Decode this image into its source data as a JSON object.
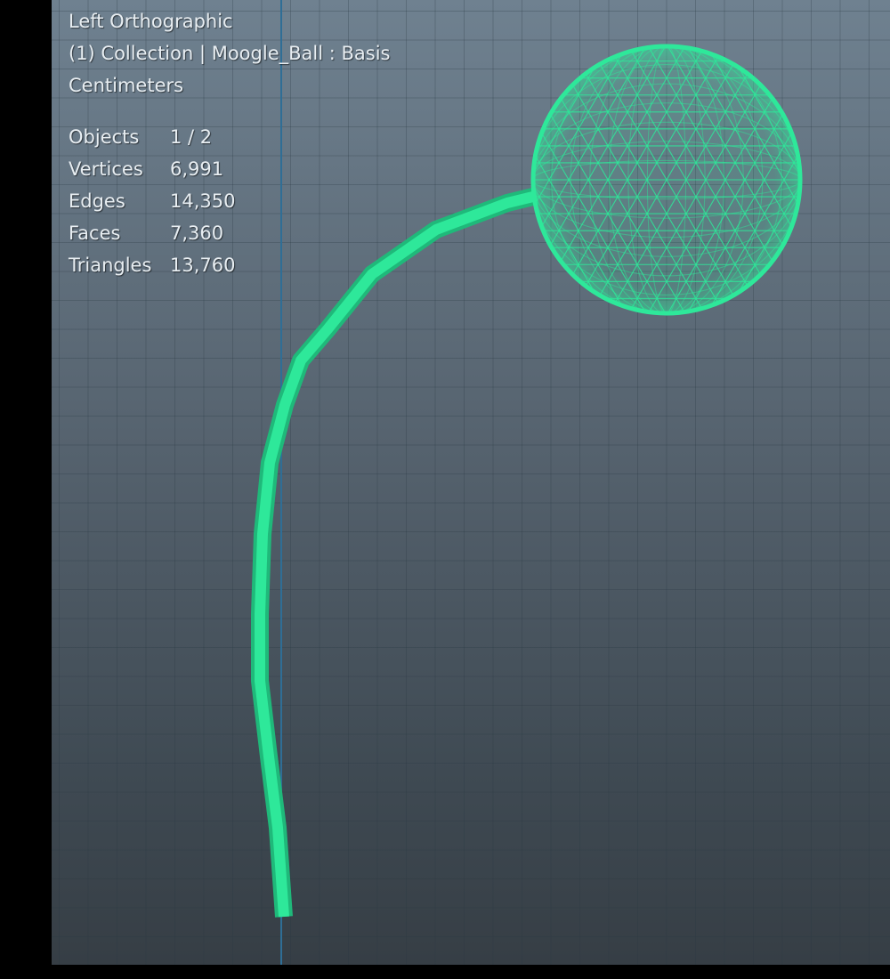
{
  "viewport": {
    "view_name": "Left Orthographic",
    "collection_info": "(1) Collection | Moogle_Ball : Basis",
    "units": "Centimeters"
  },
  "stats": [
    {
      "label": "Objects",
      "value": "1 / 2"
    },
    {
      "label": "Vertices",
      "value": "6,991"
    },
    {
      "label": "Edges",
      "value": "14,350"
    },
    {
      "label": "Faces",
      "value": "7,360"
    },
    {
      "label": "Triangles",
      "value": "13,760"
    }
  ],
  "colors": {
    "wireframe": "#2ee89a",
    "axis": "#2f6e96",
    "background_top": "#6f8190",
    "background_bottom": "#363e45"
  },
  "objects": [
    {
      "name": "stem",
      "icon": "curve-mesh"
    },
    {
      "name": "ball",
      "icon": "uv-sphere-wireframe"
    }
  ]
}
